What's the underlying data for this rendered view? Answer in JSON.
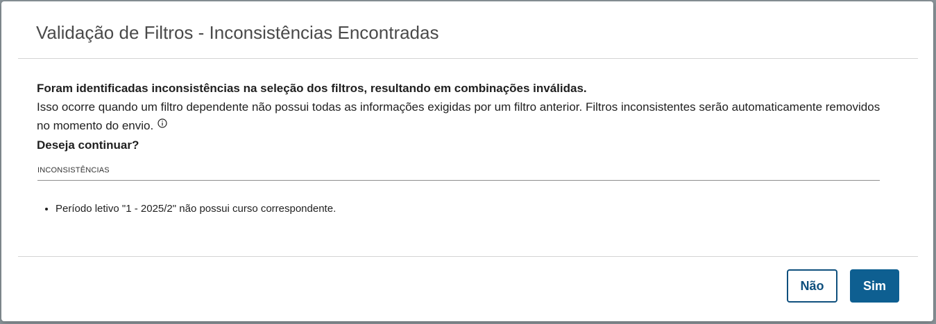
{
  "dialog": {
    "title": "Validação de Filtros - Inconsistências Encontradas",
    "message_bold": "Foram identificadas inconsistências na seleção dos filtros, resultando em combinações inválidas.",
    "message_detail": "Isso ocorre quando um filtro dependente não possui todas as informações exigidas por um filtro anterior. Filtros inconsistentes serão automaticamente removidos no momento do envio.",
    "question": "Deseja continuar?",
    "section_label": "INCONSISTÊNCIAS",
    "issues": [
      "Período letivo \"1 - 2025/2\" não possui curso correspondente."
    ],
    "buttons": {
      "no": "Não",
      "yes": "Sim"
    }
  },
  "colors": {
    "primary": "#0e5f91",
    "primary_border": "#0e4f7d",
    "title_text": "#4a4a4a",
    "backdrop": "#8a9499"
  },
  "icons": {
    "info": "info-circle-icon"
  }
}
